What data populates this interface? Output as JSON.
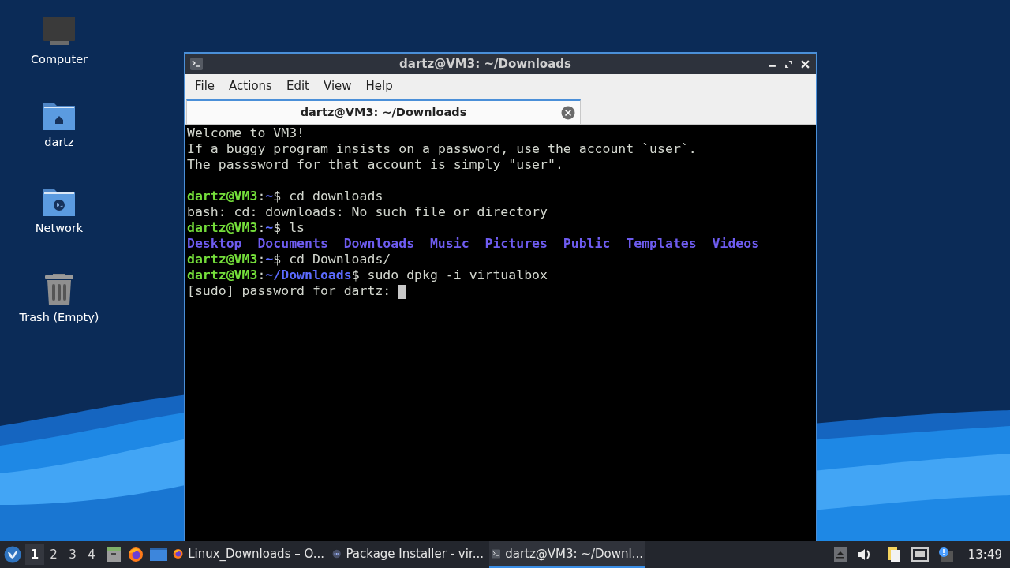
{
  "desktop_icons": [
    {
      "label": "Computer",
      "kind": "computer"
    },
    {
      "label": "dartz",
      "kind": "home"
    },
    {
      "label": "Network",
      "kind": "network"
    },
    {
      "label": "Trash (Empty)",
      "kind": "trash"
    }
  ],
  "window": {
    "title": "dartz@VM3: ~/Downloads",
    "menu": [
      "File",
      "Actions",
      "Edit",
      "View",
      "Help"
    ],
    "tabs": [
      {
        "label": "dartz@VM3: ~/Downloads",
        "selected": true
      }
    ],
    "terminal_lines": [
      {
        "kind": "text",
        "segments": [
          {
            "kind": "plain",
            "text": "Welcome to VM3!"
          }
        ]
      },
      {
        "kind": "text",
        "segments": [
          {
            "kind": "plain",
            "text": "If a buggy program insists on a password, use the account `user`."
          }
        ]
      },
      {
        "kind": "text",
        "segments": [
          {
            "kind": "plain",
            "text": "The passsword for that account is simply \"user\"."
          }
        ]
      },
      {
        "kind": "blank"
      },
      {
        "kind": "text",
        "segments": [
          {
            "kind": "user",
            "text": "dartz@VM3"
          },
          {
            "kind": "plain",
            "text": ":"
          },
          {
            "kind": "path",
            "text": "~"
          },
          {
            "kind": "plain",
            "text": "$ cd downloads"
          }
        ]
      },
      {
        "kind": "text",
        "segments": [
          {
            "kind": "plain",
            "text": "bash: cd: downloads: No such file or directory"
          }
        ]
      },
      {
        "kind": "text",
        "segments": [
          {
            "kind": "user",
            "text": "dartz@VM3"
          },
          {
            "kind": "plain",
            "text": ":"
          },
          {
            "kind": "path",
            "text": "~"
          },
          {
            "kind": "plain",
            "text": "$ ls"
          }
        ]
      },
      {
        "kind": "listing",
        "items": [
          "Desktop",
          "Documents",
          "Downloads",
          "Music",
          "Pictures",
          "Public",
          "Templates",
          "Videos"
        ]
      },
      {
        "kind": "text",
        "segments": [
          {
            "kind": "user",
            "text": "dartz@VM3"
          },
          {
            "kind": "plain",
            "text": ":"
          },
          {
            "kind": "path",
            "text": "~"
          },
          {
            "kind": "plain",
            "text": "$ cd Downloads/"
          }
        ]
      },
      {
        "kind": "text",
        "segments": [
          {
            "kind": "user",
            "text": "dartz@VM3"
          },
          {
            "kind": "plain",
            "text": ":"
          },
          {
            "kind": "path",
            "text": "~/Downloads"
          },
          {
            "kind": "plain",
            "text": "$ sudo dpkg -i virtualbox"
          }
        ]
      },
      {
        "kind": "text",
        "segments": [
          {
            "kind": "plain",
            "text": "[sudo] password for dartz: "
          },
          {
            "kind": "cursor"
          }
        ]
      }
    ]
  },
  "taskbar": {
    "workspaces": [
      {
        "label": "1",
        "selected": true
      },
      {
        "label": "2",
        "selected": false
      },
      {
        "label": "3",
        "selected": false
      },
      {
        "label": "4",
        "selected": false
      }
    ],
    "launchers": [
      {
        "kind": "files"
      },
      {
        "kind": "browser"
      },
      {
        "kind": "desktop"
      }
    ],
    "tasks": [
      {
        "label": "Linux_Downloads – O...",
        "kind": "browser",
        "selected": false
      },
      {
        "label": "Package Installer - vir...",
        "kind": "installer",
        "selected": false
      },
      {
        "label": "dartz@VM3: ~/Downl...",
        "kind": "terminal",
        "selected": true
      }
    ],
    "clock": "13:49"
  }
}
